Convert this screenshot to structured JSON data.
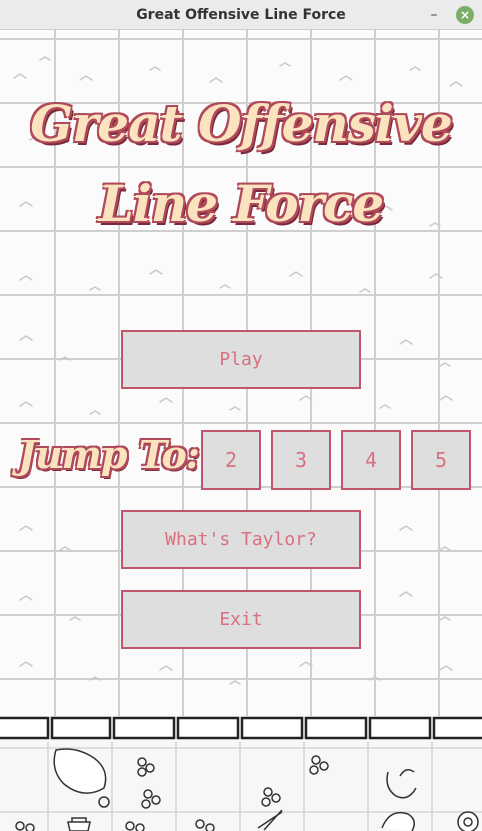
{
  "window": {
    "title": "Great Offensive Line Force",
    "minimize_glyph": "–",
    "close_glyph": "×",
    "close_color": "#7cae6a"
  },
  "game": {
    "title_line1": "Great Offensive",
    "title_line2": "Line Force",
    "play_label": "Play",
    "jump_label": "Jump To:",
    "levels": [
      "2",
      "3",
      "4",
      "5"
    ],
    "taylor_label": "What's Taylor?",
    "exit_label": "Exit",
    "colors": {
      "button_border": "#c0566a",
      "button_text": "#d9707f",
      "button_fill": "#dedede",
      "title_fill": "#fbe3c0",
      "title_outline": "#b04a5a"
    }
  }
}
